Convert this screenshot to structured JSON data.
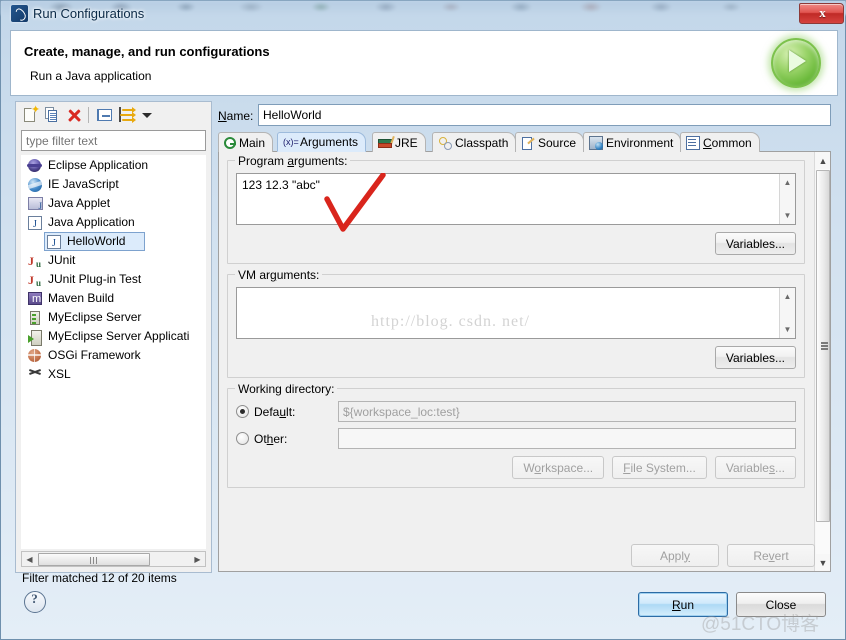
{
  "window": {
    "title": "Run Configurations",
    "app_icon": "eclipse-run-icon",
    "close_label": "x"
  },
  "header": {
    "title": "Create, manage, and run configurations",
    "subtitle": "Run a Java application",
    "badge_icon": "green-run-play-icon"
  },
  "sidebar": {
    "toolbar": [
      {
        "name": "new-configuration",
        "icon": "new-document-icon"
      },
      {
        "name": "duplicate-configuration",
        "icon": "duplicate-icon"
      },
      {
        "name": "delete-configuration",
        "icon": "delete-red-x-icon"
      },
      {
        "name": "collapse-all",
        "icon": "collapse-all-icon"
      },
      {
        "name": "filter-configurations",
        "icon": "filter-arrows-icon"
      },
      {
        "name": "view-menu",
        "icon": "chevron-down-icon"
      }
    ],
    "filter": {
      "value": "",
      "placeholder": "type filter text"
    },
    "tree": [
      {
        "label": "Eclipse Application",
        "icon": "eclipse-icon",
        "indent": 0,
        "selected": false
      },
      {
        "label": "IE JavaScript",
        "icon": "ie-globe-icon",
        "indent": 0,
        "selected": false
      },
      {
        "label": "Java Applet",
        "icon": "java-applet-icon",
        "indent": 0,
        "selected": false
      },
      {
        "label": "Java Application",
        "icon": "java-application-icon",
        "indent": 0,
        "selected": false
      },
      {
        "label": "HelloWorld",
        "icon": "java-application-icon",
        "indent": 1,
        "selected": true
      },
      {
        "label": "JUnit",
        "icon": "junit-icon",
        "indent": 0,
        "selected": false
      },
      {
        "label": "JUnit Plug-in Test",
        "icon": "junit-plugin-icon",
        "indent": 0,
        "selected": false
      },
      {
        "label": "Maven Build",
        "icon": "maven-icon",
        "indent": 0,
        "selected": false
      },
      {
        "label": "MyEclipse Server",
        "icon": "server-icon",
        "indent": 0,
        "selected": false
      },
      {
        "label": "MyEclipse Server Applicati",
        "icon": "server-application-icon",
        "indent": 0,
        "selected": false
      },
      {
        "label": "OSGi Framework",
        "icon": "osgi-icon",
        "indent": 0,
        "selected": false
      },
      {
        "label": "XSL",
        "icon": "xsl-icon",
        "indent": 0,
        "selected": false
      }
    ],
    "status": "Filter matched 12 of 20 items"
  },
  "content": {
    "name_label": "Name:",
    "name_value": "HelloWorld",
    "tabs": [
      {
        "label": "Main",
        "icon": "main-tab-icon",
        "active": false
      },
      {
        "label": "Arguments",
        "icon": "arguments-tab-icon",
        "active": true
      },
      {
        "label": "JRE",
        "icon": "jre-tab-icon",
        "active": false
      },
      {
        "label": "Classpath",
        "icon": "classpath-tab-icon",
        "active": false
      },
      {
        "label": "Source",
        "icon": "source-tab-icon",
        "active": false
      },
      {
        "label": "Environment",
        "icon": "environment-tab-icon",
        "active": false
      },
      {
        "label": "Common",
        "icon": "common-tab-icon",
        "active": false
      }
    ],
    "program_arguments": {
      "legend": "Program arguments:",
      "value": "123 12.3 \"abc\"",
      "variables_button": "Variables..."
    },
    "vm_arguments": {
      "legend": "VM arguments:",
      "value": "",
      "variables_button": "Variables..."
    },
    "working_directory": {
      "legend": "Working directory:",
      "default_label": "Default:",
      "default_value": "${workspace_loc:test}",
      "default_selected": true,
      "other_label": "Other:",
      "other_value": "",
      "other_selected": false,
      "workspace_button": "Workspace...",
      "filesystem_button": "File System...",
      "variables_button": "Variables..."
    },
    "apply_button": "Apply",
    "revert_button": "Revert"
  },
  "footer": {
    "help_icon": "help-question-icon",
    "run_button": "Run",
    "close_button": "Close"
  },
  "watermarks": {
    "csdn": "http://blog. csdn. net/",
    "cto": "@51CTO博客"
  },
  "annotation": {
    "type": "red-check-mark",
    "color": "#d9251c"
  },
  "colors": {
    "accent": "#3b7fc4",
    "selection": "#dcebfb",
    "delete_red": "#d92a22",
    "run_green": "#7cc24c",
    "annotation_red": "#d9251c"
  }
}
